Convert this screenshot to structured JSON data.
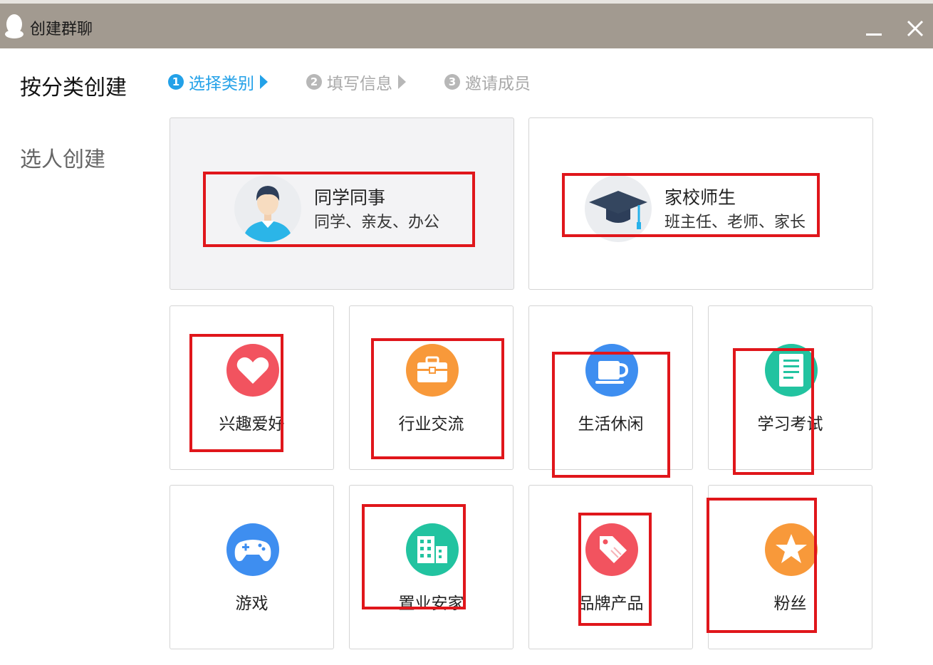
{
  "window": {
    "title": "创建群聊",
    "minimize_icon": "minimize-icon",
    "close_icon": "close-icon"
  },
  "sidebar": {
    "items": [
      {
        "label": "按分类创建"
      },
      {
        "label": "选人创建"
      }
    ]
  },
  "steps": [
    {
      "num": "1",
      "label": "选择类别"
    },
    {
      "num": "2",
      "label": "填写信息"
    },
    {
      "num": "3",
      "label": "邀请成员"
    }
  ],
  "featured_categories": [
    {
      "title": "同学同事",
      "subtitle": "同学、亲友、办公",
      "icon": "student-avatar-icon"
    },
    {
      "title": "家校师生",
      "subtitle": "班主任、老师、家长",
      "icon": "graduation-cap-icon"
    }
  ],
  "categories": [
    {
      "label": "兴趣爱好",
      "icon": "heart-icon",
      "color": "#f2535f"
    },
    {
      "label": "行业交流",
      "icon": "briefcase-icon",
      "color": "#f8993a"
    },
    {
      "label": "生活休闲",
      "icon": "cup-icon",
      "color": "#3e8ef0"
    },
    {
      "label": "学习考试",
      "icon": "document-icon",
      "color": "#22c3a0"
    },
    {
      "label": "游戏",
      "icon": "gamepad-icon",
      "color": "#3e8ef0"
    },
    {
      "label": "置业安家",
      "icon": "building-icon",
      "color": "#22c3a0"
    },
    {
      "label": "品牌产品",
      "icon": "tag-icon",
      "color": "#f2535f"
    },
    {
      "label": "粉丝",
      "icon": "star-icon",
      "color": "#f8993a"
    }
  ],
  "colors": {
    "accent": "#23a1e8",
    "titlebar": "#a29a90",
    "highlight": "#e0161b"
  }
}
